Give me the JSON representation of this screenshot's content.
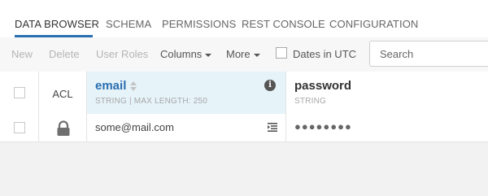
{
  "tabs": [
    {
      "label": "DATA BROWSER",
      "active": true
    },
    {
      "label": "SCHEMA"
    },
    {
      "label": "PERMISSIONS"
    },
    {
      "label": "REST CONSOLE"
    },
    {
      "label": "CONFIGURATION"
    }
  ],
  "toolbar": {
    "new_label": "New",
    "delete_label": "Delete",
    "user_roles_label": "User Roles",
    "columns_label": "Columns",
    "more_label": "More",
    "dates_utc_label": "Dates in UTC",
    "search_placeholder": "Search"
  },
  "grid": {
    "acl_header": "ACL",
    "columns": [
      {
        "name": "email",
        "type": "STRING | MAX LENGTH: 250"
      },
      {
        "name": "password",
        "type": "STRING"
      }
    ],
    "rows": [
      {
        "email": "some@mail.com",
        "password": "●●●●●●●●"
      }
    ]
  },
  "colors": {
    "accent": "#2a6fb0",
    "selected_column_bg": "#e6f3f9"
  }
}
